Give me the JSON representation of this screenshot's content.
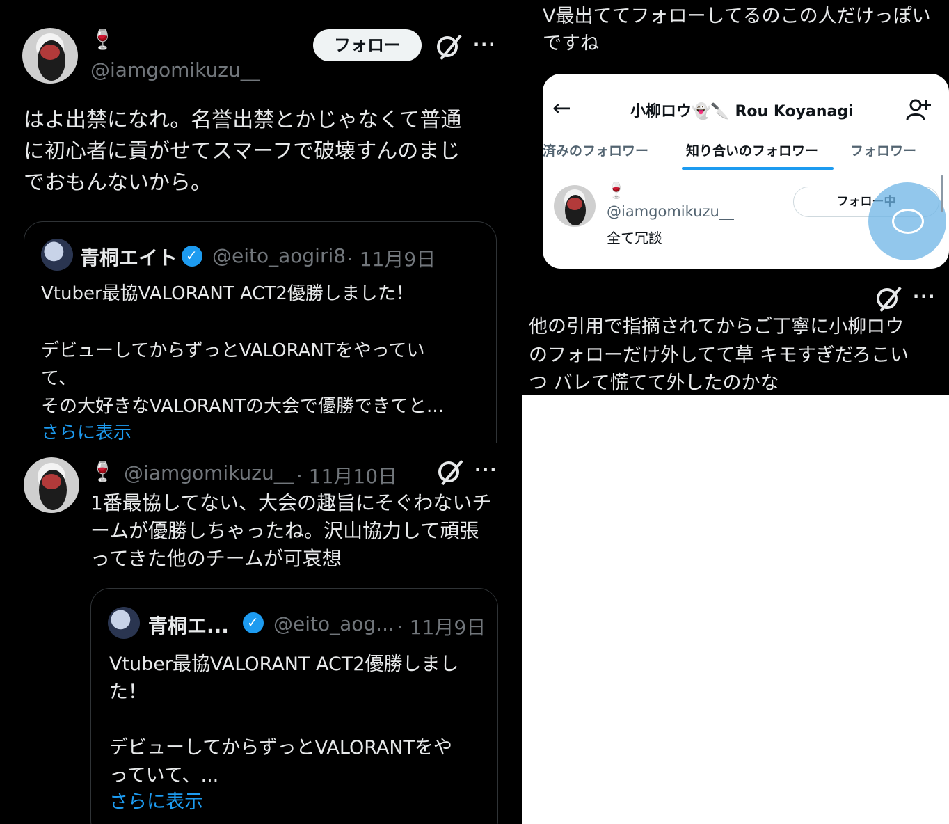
{
  "left_top": {
    "wine_emoji": "🍷",
    "username": "@iamgomikuzu__",
    "follow_label": "フォロー",
    "more_label": "···",
    "post_lines": [
      "はよ出禁になれ。名誉出禁とかじゃなくて普通",
      "に初心者に貢がせてスマーフで破壊すんのまじ",
      "でおもんないから。"
    ],
    "quote": {
      "display_name": "青桐エイト",
      "handle": "@eito_aogiri8",
      "date": "· 11月9日",
      "line1": "Vtuber最協VALORANT ACT2優勝しました！",
      "line2": "デビューしてからずっとVALORANTをやってい",
      "line3": "て、",
      "line4": "その大好きなVALORANTの大会で優勝できてと...",
      "show_more": "さらに表示"
    }
  },
  "left_bottom": {
    "wine_emoji": "🍷",
    "username": "@iamgomikuzu__",
    "date": "· 11月10日",
    "more_label": "···",
    "post_lines": [
      "1番最協してない、大会の趣旨にそぐわないチ",
      "ームが優勝しちゃったね。沢山協力して頑張",
      "ってきた他のチームが可哀想"
    ],
    "quote": {
      "display_name": "青桐エ...",
      "handle": "@eito_aog...",
      "date": "· 11月9日",
      "line1": "Vtuber最協VALORANT ACT2優勝しまし",
      "line2": "た！",
      "line3": "デビューしてからずっとVALORANTをや",
      "line4": "っていて、...",
      "show_more": "さらに表示"
    }
  },
  "right_panel": {
    "intro_lines": [
      "V最出ててフォローしてるのこの人だけっぽい",
      "ですね"
    ],
    "card": {
      "back_icon": "←",
      "title_name": "小柳ロウ",
      "title_emoji": "👻🔪",
      "title_en": "Rou Koyanagi",
      "add_user_icon": "person-add-icon",
      "tabs": [
        "済みのフォロワー",
        "知り合いのフォロワー",
        "フォロワー"
      ],
      "active_tab_index": 1,
      "row": {
        "wine_emoji": "🍷",
        "username": "@iamgomikuzu__",
        "bio": "全て冗談",
        "button_label": "フォロー中"
      }
    },
    "more_label": "···",
    "comment_lines": [
      "他の引用で指摘されてからご丁寧に小柳ロウ",
      "のフォローだけ外してて草 キモすぎだろこい",
      "つ バレて慌てて外したのかな"
    ]
  },
  "colors": {
    "background": "#000000",
    "text": "#e7e9ea",
    "muted": "#71767b",
    "link": "#1d9bf0",
    "card_bg": "#ffffff"
  }
}
